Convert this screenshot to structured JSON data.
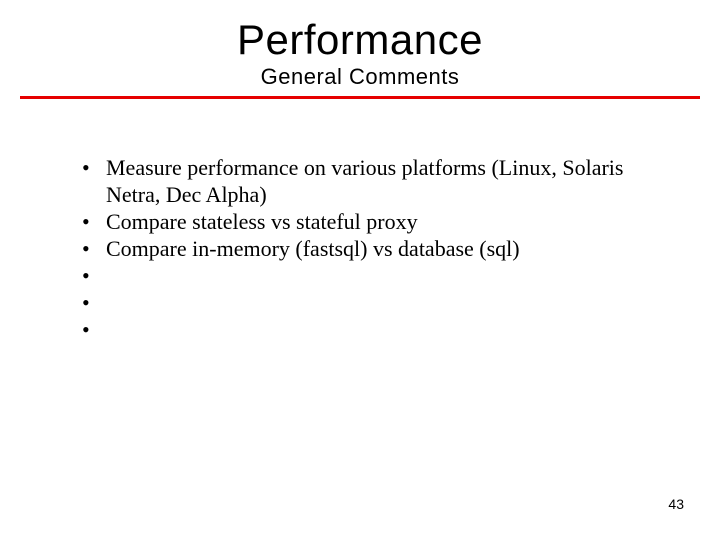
{
  "header": {
    "title": "Performance",
    "subtitle": "General Comments"
  },
  "bullets": [
    "Measure performance on various platforms (Linux, Solaris Netra, Dec Alpha)",
    "Compare stateless vs stateful proxy",
    "Compare in-memory (fastsql) vs database (sql)",
    "",
    "",
    ""
  ],
  "page_number": "43"
}
